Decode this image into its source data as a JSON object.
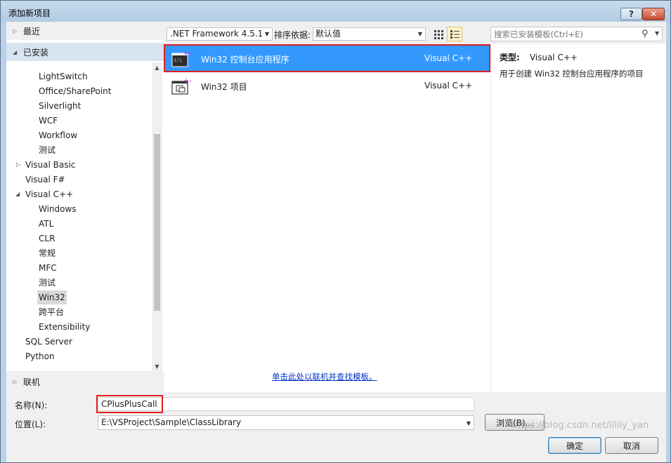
{
  "window": {
    "title": "添加新项目"
  },
  "sidebar": {
    "recent_label": "最近",
    "installed_label": "已安装",
    "online_label": "联机",
    "tree": [
      {
        "label": "LightSwitch"
      },
      {
        "label": "Office/SharePoint"
      },
      {
        "label": "Silverlight"
      },
      {
        "label": "WCF"
      },
      {
        "label": "Workflow"
      },
      {
        "label": "测试"
      },
      {
        "label": "Visual Basic"
      },
      {
        "label": "Visual F#"
      },
      {
        "label": "Visual C++"
      },
      {
        "label": "Windows"
      },
      {
        "label": "ATL"
      },
      {
        "label": "CLR"
      },
      {
        "label": "常规"
      },
      {
        "label": "MFC"
      },
      {
        "label": "测试"
      },
      {
        "label": "Win32"
      },
      {
        "label": "跨平台"
      },
      {
        "label": "Extensibility"
      },
      {
        "label": "SQL Server"
      },
      {
        "label": "Python"
      }
    ]
  },
  "toolbar": {
    "framework": ".NET Framework 4.5.1",
    "sort_label": "排序依据:",
    "sort_value": "默认值",
    "search_placeholder": "搜索已安装模板(Ctrl+E)"
  },
  "templates": [
    {
      "name": "Win32 控制台应用程序",
      "language": "Visual C++",
      "selected": true
    },
    {
      "name": "Win32 项目",
      "language": "Visual C++",
      "selected": false
    }
  ],
  "online_link": "单击此处以联机并查找模板。",
  "description": {
    "type_label": "类型:",
    "type_value": "Visual C++",
    "text": "用于创建 Win32 控制台应用程序的项目"
  },
  "form": {
    "name_label": "名称(N):",
    "name_value": "CPlusPlusCall",
    "location_label": "位置(L):",
    "location_value": "E:\\VSProject\\Sample\\ClassLibrary",
    "browse_label": "浏览(B)...",
    "ok_label": "确定",
    "cancel_label": "取消"
  },
  "watermark": "https://blog.csdn.net/lilily_yan",
  "colors": {
    "selection": "#3399ff",
    "highlight_border": "#e02020",
    "link": "#0033cc"
  }
}
